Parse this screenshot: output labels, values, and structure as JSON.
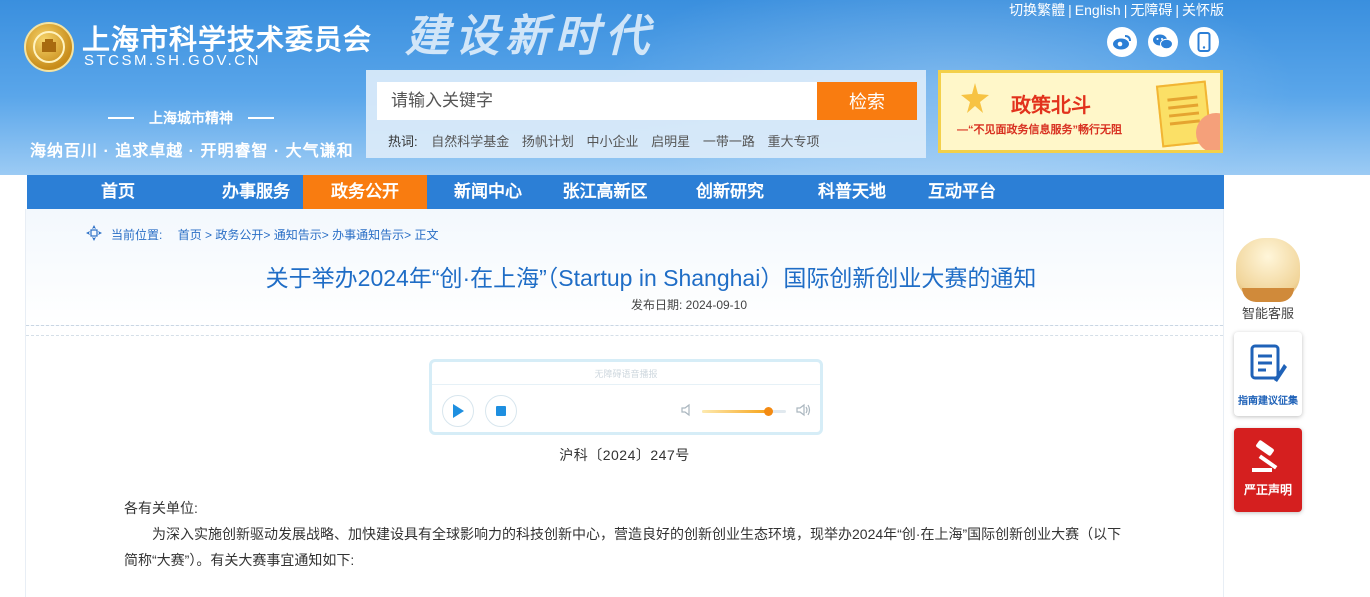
{
  "header": {
    "site_title": "上海市科学技术委员会",
    "site_domain": "STCSM.SH.GOV.CN",
    "calligraphy": "建设新时代",
    "spirit_label": "上海城市精神",
    "spirit_text": "海纳百川 · 追求卓越 · 开明睿智 · 大气谦和",
    "top_links": [
      "切换繁體",
      "English",
      "无障碍",
      "关怀版"
    ],
    "social_icons": [
      "weibo-icon",
      "wechat-icon",
      "mobile-icon"
    ]
  },
  "search": {
    "placeholder": "请输入关键字",
    "button_label": "检索",
    "hot_label": "热词:",
    "hot_words": [
      "自然科学基金",
      "扬帆计划",
      "中小企业",
      "启明星",
      "一带一路",
      "重大专项"
    ]
  },
  "banner": {
    "title": "政策北斗",
    "subtitle": "—“不见面政务信息服务”畅行无阻"
  },
  "nav": {
    "items": [
      "首页",
      "办事服务",
      "政务公开",
      "新闻中心",
      "张江高新区",
      "创新研究",
      "科普天地",
      "互动平台"
    ],
    "active": "政务公开"
  },
  "breadcrumb": {
    "label": "当前位置:",
    "items": [
      "首页",
      "政务公开",
      "通知告示",
      "办事通知告示",
      "正文"
    ]
  },
  "article": {
    "title": "关于举办2024年“创·在上海”（Startup in Shanghai）国际创新创业大赛的通知",
    "date_label": "发布日期:",
    "date": "2024-09-10",
    "doc_number": "沪科〔2024〕247号",
    "salutation": "各有关单位:",
    "paragraph": "为深入实施创新驱动发展战略、加快建设具有全球影响力的科技创新中心，营造良好的创新创业生态环境，现举办2024年“创·在上海”国际创新创业大赛（以下简称“大赛”）。有关大赛事宜通知如下:"
  },
  "player": {
    "title": "无障碍语音播报",
    "volume": 0.78
  },
  "float": {
    "bot_label": "智能客服",
    "guide_label": "指南建议征集",
    "declare_label": "严正声明"
  },
  "colors": {
    "nav_bg": "#2c7fd6",
    "accent_orange": "#f97c10",
    "title_blue": "#1f6dc6",
    "declare_red": "#d51f1f"
  }
}
